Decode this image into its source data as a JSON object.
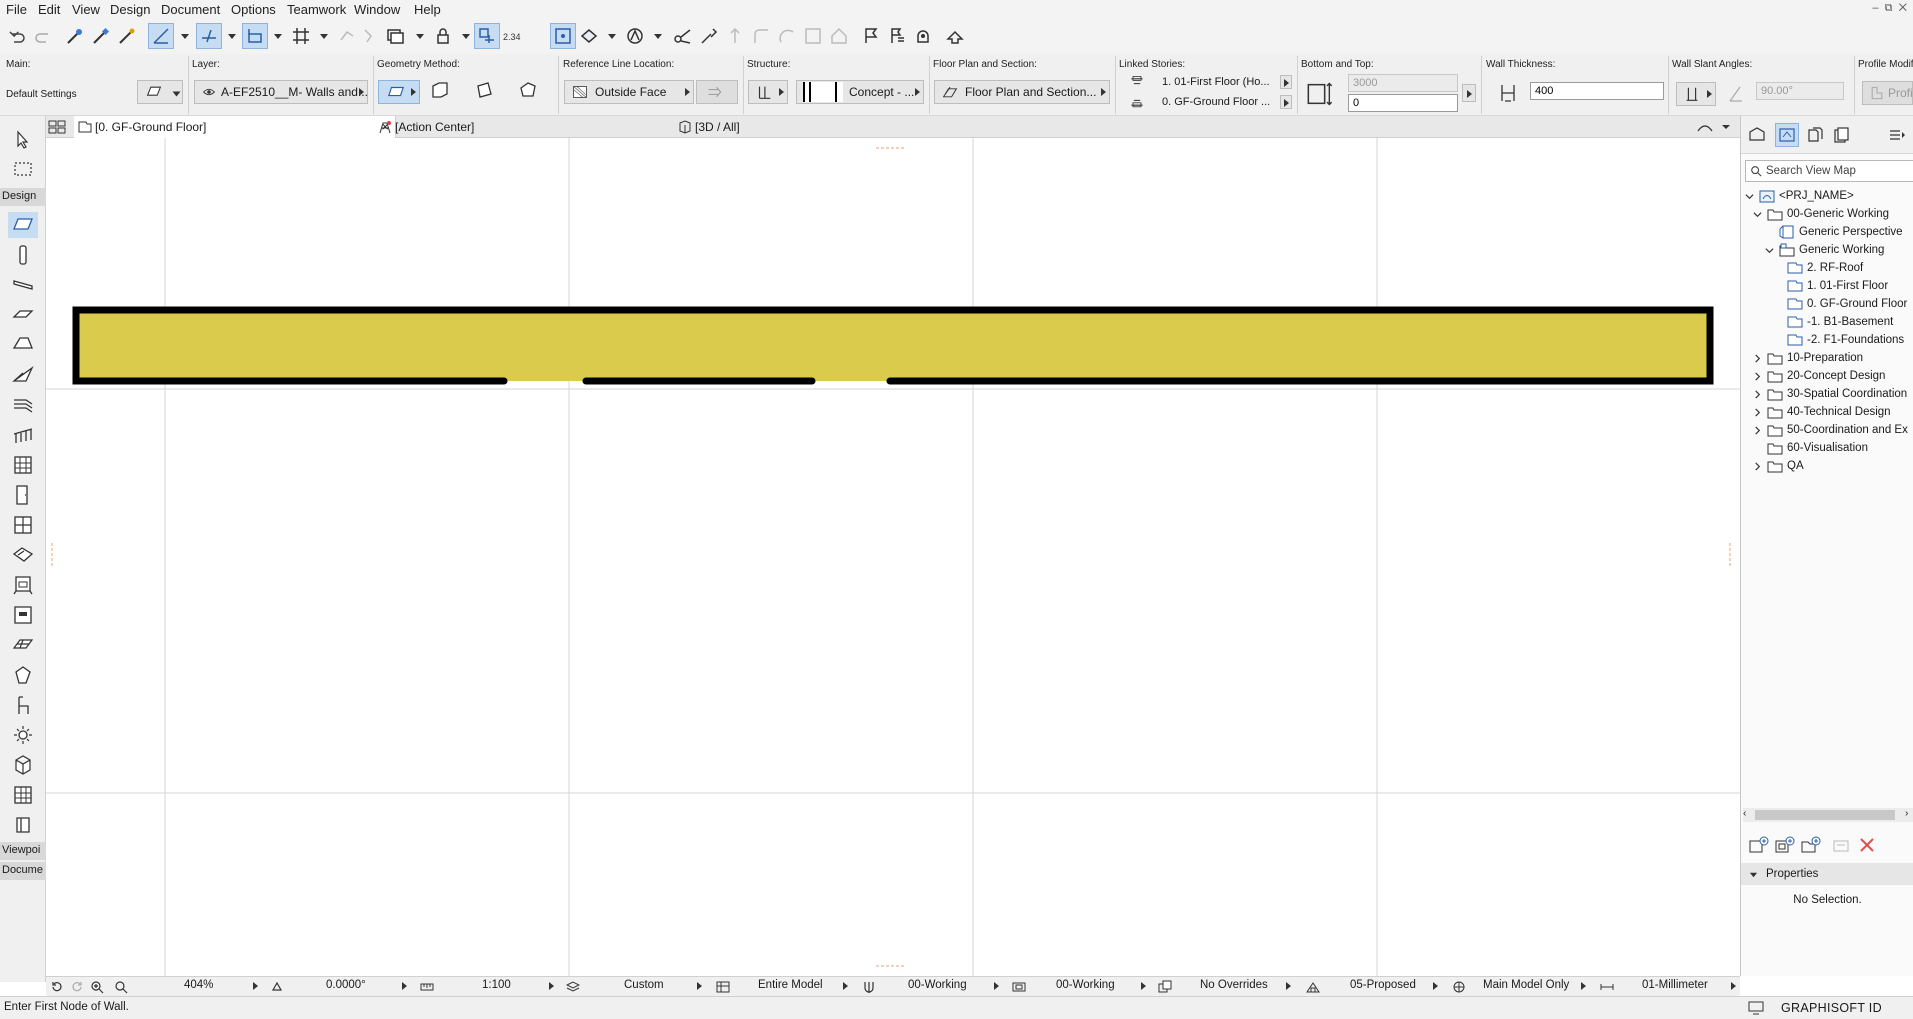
{
  "menu": [
    "File",
    "Edit",
    "View",
    "Design",
    "Document",
    "Options",
    "Teamwork",
    "Window",
    "Help"
  ],
  "infobox": {
    "main_label": "Main:",
    "main_value": "Default Settings",
    "layer_label": "Layer:",
    "layer_value": "A-EF2510__M- Walls and...",
    "geometry_label": "Geometry Method:",
    "refline_label": "Reference Line Location:",
    "refline_value": "Outside Face",
    "structure_label": "Structure:",
    "structure_value": "Concept - ...",
    "fps_label": "Floor Plan and Section:",
    "fps_value": "Floor Plan and Section...",
    "linked_label": "Linked Stories:",
    "linked_top": "1. 01-First Floor (Ho...",
    "linked_bottom": "0. GF-Ground Floor ...",
    "bt_label": "Bottom and Top:",
    "top_value": "3000",
    "bottom_value": "0",
    "thickness_label": "Wall Thickness:",
    "thickness_value": "400",
    "slant_label": "Wall Slant Angles:",
    "slant_value": "90.00°",
    "profile_label": "Profile Modifi",
    "profile_button": "Profi"
  },
  "toolbox": {
    "design_header": "Design",
    "viewpoint_header": "Viewpoi",
    "document_header": "Docume"
  },
  "tabs": [
    {
      "label": "[0. GF-Ground Floor]",
      "close": "×"
    },
    {
      "label": "[Action Center]"
    },
    {
      "label": "[3D / All]"
    }
  ],
  "quick_options": {
    "zoom": "404%",
    "angle": "0.0000°",
    "scale": "1:100",
    "layer_combo": "Custom",
    "model_view": "Entire Model",
    "pen_set": "00-Working",
    "model_view_options": "00-Working",
    "overrides": "No Overrides",
    "renovation": "05-Proposed",
    "structure_display": "Main Model Only",
    "dimension": "01-Millimeter"
  },
  "status": {
    "message": "Enter First Node of Wall.",
    "graphisoft_id": "GRAPHISOFT ID"
  },
  "navigator": {
    "search_placeholder": "Search View Map",
    "tree": [
      {
        "label": "<PRJ_NAME>",
        "level": 0,
        "twisty": "open",
        "icon": "project"
      },
      {
        "label": "00-Generic Working",
        "level": 1,
        "twisty": "open",
        "icon": "folder"
      },
      {
        "label": "Generic Perspective",
        "level": 2,
        "twisty": "none",
        "icon": "perspective"
      },
      {
        "label": "Generic Working",
        "level": 2,
        "twisty": "open",
        "icon": "folderview"
      },
      {
        "label": "2. RF-Roof",
        "level": 3,
        "twisty": "none",
        "icon": "story"
      },
      {
        "label": "1. 01-First Floor",
        "level": 3,
        "twisty": "none",
        "icon": "story"
      },
      {
        "label": "0. GF-Ground Floor",
        "level": 3,
        "twisty": "none",
        "icon": "story"
      },
      {
        "label": "-1. B1-Basement",
        "level": 3,
        "twisty": "none",
        "icon": "story"
      },
      {
        "label": "-2. F1-Foundations",
        "level": 3,
        "twisty": "none",
        "icon": "story"
      },
      {
        "label": "10-Preparation",
        "level": 1,
        "twisty": "closed",
        "icon": "folder"
      },
      {
        "label": "20-Concept Design",
        "level": 1,
        "twisty": "closed",
        "icon": "folder"
      },
      {
        "label": "30-Spatial Coordination",
        "level": 1,
        "twisty": "closed",
        "icon": "folder"
      },
      {
        "label": "40-Technical Design",
        "level": 1,
        "twisty": "closed",
        "icon": "folder"
      },
      {
        "label": "50-Coordination and Ex",
        "level": 1,
        "twisty": "closed",
        "icon": "folder"
      },
      {
        "label": "60-Visualisation",
        "level": 1,
        "twisty": "none",
        "icon": "folder"
      },
      {
        "label": "QA",
        "level": 1,
        "twisty": "closed",
        "icon": "folder"
      }
    ],
    "properties_header": "Properties",
    "properties_body": "No Selection."
  },
  "colors": {
    "wall_fill": "#dbcb4c",
    "wall_outline": "#000000",
    "selection_blue": "#c6dcf3",
    "grid_line": "#d6d6d6",
    "delete_red": "#e05050"
  }
}
